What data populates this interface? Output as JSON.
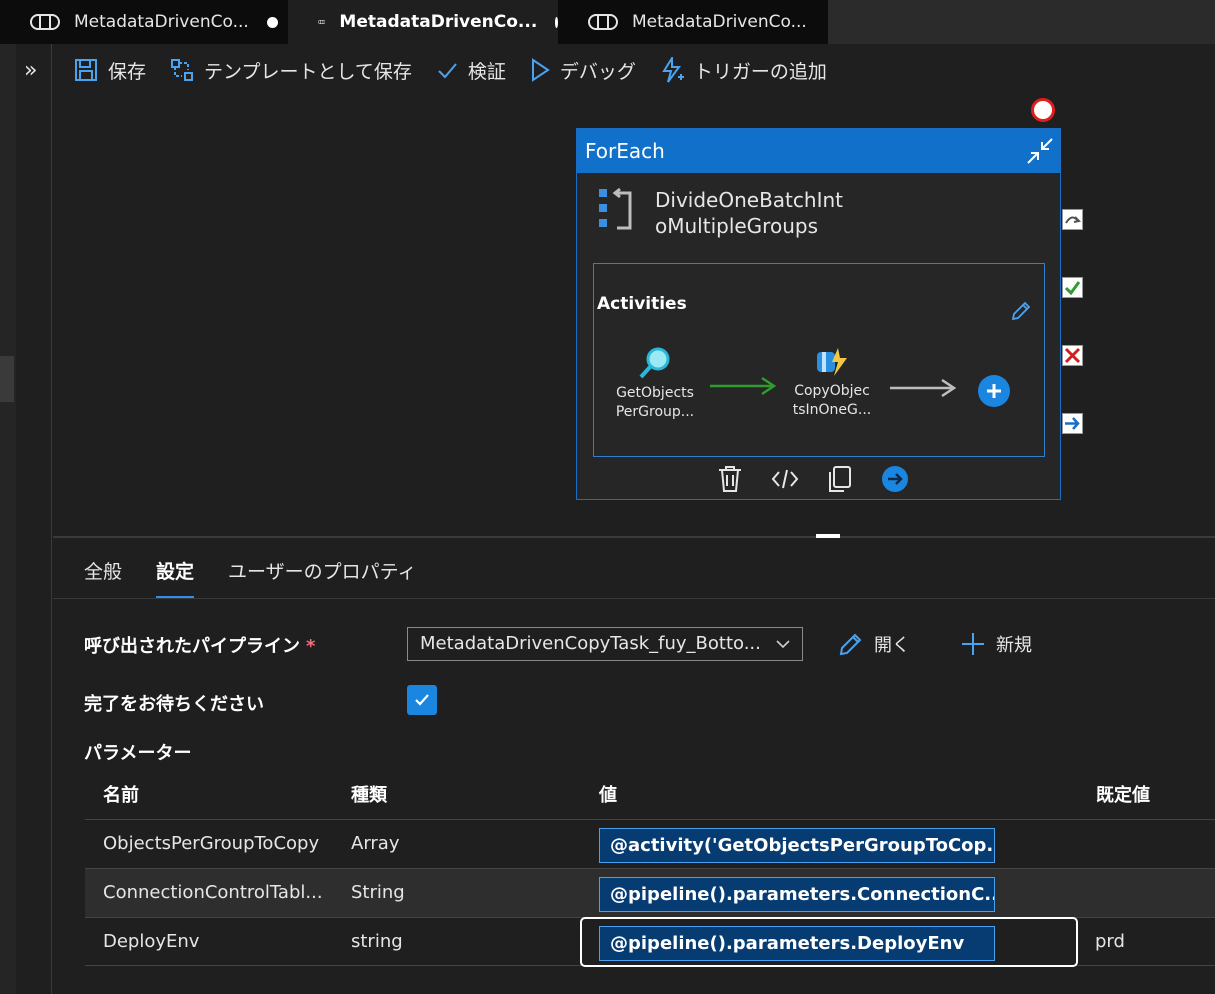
{
  "tabs": [
    {
      "label": "MetadataDrivenCo...",
      "unsaved": true
    },
    {
      "label": "MetadataDrivenCo...",
      "unsaved": true,
      "active": true
    },
    {
      "label": "MetadataDrivenCo...",
      "unsaved": false
    }
  ],
  "rail": {
    "expand_glyph": "»"
  },
  "toolbar": {
    "save": "保存",
    "save_template": "テンプレートとして保存",
    "validate": "検証",
    "debug": "デバッグ",
    "add_trigger": "トリガーの追加"
  },
  "foreach": {
    "header": "ForEach",
    "name_line1": "DivideOneBatchInt",
    "name_line2": "oMultipleGroups",
    "activities_label": "Activities",
    "nodes": [
      {
        "line1": "GetObjects",
        "line2": "PerGroup..."
      },
      {
        "line1": "CopyObjec",
        "line2": "tsInOneG..."
      }
    ]
  },
  "panel": {
    "tabs": [
      "全般",
      "設定",
      "ユーザーのプロパティ"
    ],
    "active_tab": "設定",
    "invoked_pipeline_label": "呼び出されたパイプライン",
    "required_mark": "*",
    "invoked_pipeline_value": "MetadataDrivenCopyTask_fuy_Botto...",
    "open_label": "開く",
    "new_label": "新規",
    "wait_label": "完了をお待ちください",
    "wait_checked": true,
    "params_label": "パラメーター",
    "columns": {
      "name": "名前",
      "type": "種類",
      "value": "値",
      "default": "既定値"
    },
    "rows": [
      {
        "name": "ObjectsPerGroupToCopy",
        "type": "Array",
        "value": "@activity('GetObjectsPerGroupToCop...",
        "default": ""
      },
      {
        "name": "ConnectionControlTabl...",
        "type": "String",
        "value": "@pipeline().parameters.ConnectionC...",
        "default": ""
      },
      {
        "name": "DeployEnv",
        "type": "string",
        "value": "@pipeline().parameters.DeployEnv",
        "default": "prd"
      }
    ]
  },
  "colors": {
    "accent": "#1170c9",
    "selected_value_bg": "#073c73",
    "success": "#2e9b2e",
    "failure": "#d01f1f"
  }
}
